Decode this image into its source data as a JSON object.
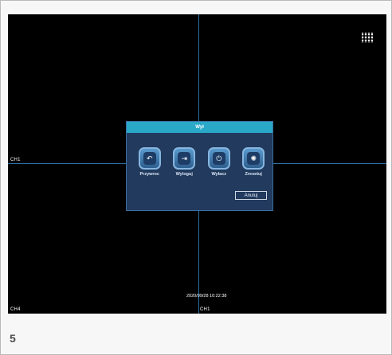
{
  "overlay": {
    "channel_labels": {
      "left_mid": "CH1",
      "bottom_left": "CH4",
      "bottom_mid": "CH1"
    },
    "datetime": "2020/09/28 10:22:38"
  },
  "dialog": {
    "title": "Wył",
    "actions": [
      {
        "label": "Przywroc",
        "icon": "undo-arrow-icon"
      },
      {
        "label": "Wyloguj",
        "icon": "logout-icon"
      },
      {
        "label": "Wyłacz",
        "icon": "power-icon"
      },
      {
        "label": "Zresetuj",
        "icon": "reset-icon"
      }
    ],
    "cancel_label": "Anuluj"
  },
  "caption": "5",
  "colors": {
    "title_bar": "#29a8c8",
    "dialog_bg": "#213a5d",
    "button_gradient_top": "#5a9acd",
    "button_gradient_bottom": "#2d5e8e"
  }
}
